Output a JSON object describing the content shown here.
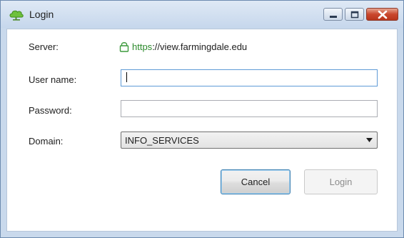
{
  "window": {
    "title": "Login",
    "app_icon": "cloud-icon",
    "controls": {
      "minimize_icon": "minimize-icon",
      "maximize_icon": "maximize-icon",
      "close_icon": "close-icon"
    }
  },
  "form": {
    "server": {
      "label": "Server:",
      "icon": "lock-icon",
      "scheme": "https",
      "rest": "://view.farmingdale.edu"
    },
    "username": {
      "label": "User name:",
      "value": "",
      "placeholder": ""
    },
    "password": {
      "label": "Password:",
      "value": "",
      "placeholder": ""
    },
    "domain": {
      "label": "Domain:",
      "selected": "INFO_SERVICES",
      "arrow_icon": "dropdown-arrow-icon"
    }
  },
  "buttons": {
    "cancel": "Cancel",
    "login": "Login",
    "login_enabled": false
  },
  "colors": {
    "secure_scheme": "#2c8a2c",
    "close_button": "#c9472d",
    "focus_border": "#5f9bd6"
  }
}
